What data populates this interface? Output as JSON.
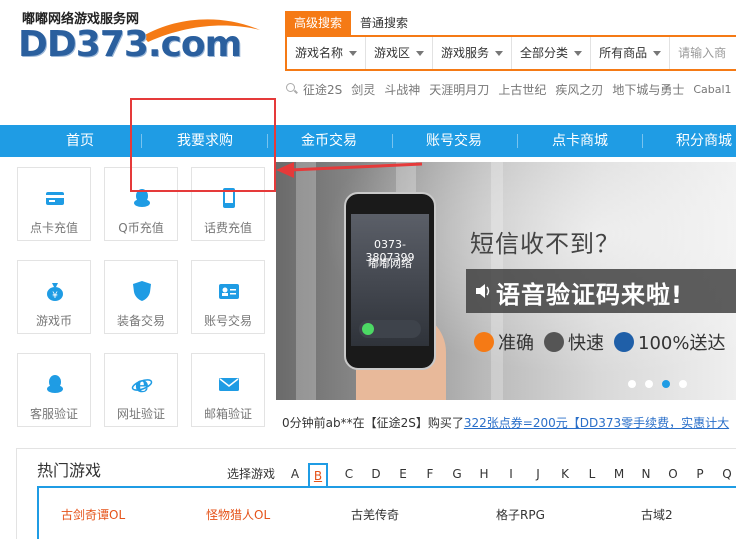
{
  "logo": {
    "tagline": "嘟嘟网络游戏服务网",
    "text": "DD373.com"
  },
  "search": {
    "tabs": [
      "高级搜索",
      "普通搜索"
    ],
    "fields": [
      "游戏名称",
      "游戏区",
      "游戏服务",
      "全部分类",
      "所有商品"
    ],
    "placeholder": "请输入商"
  },
  "hot_words": [
    "征途2S",
    "剑灵",
    "斗战神",
    "天涯明月刀",
    "上古世纪",
    "疾风之刃",
    "地下城与勇士",
    "Cabal1"
  ],
  "nav": [
    "首页",
    "我要求购",
    "金币交易",
    "账号交易",
    "点卡商城",
    "积分商城"
  ],
  "services": [
    {
      "label": "点卡充值",
      "icon": "card-icon"
    },
    {
      "label": "Q币充值",
      "icon": "qq-penguin-icon"
    },
    {
      "label": "话费充值",
      "icon": "phone-icon"
    },
    {
      "label": "游戏币",
      "icon": "money-bag-icon"
    },
    {
      "label": "装备交易",
      "icon": "shield-icon"
    },
    {
      "label": "账号交易",
      "icon": "id-card-icon"
    },
    {
      "label": "客服验证",
      "icon": "qq-penguin-icon"
    },
    {
      "label": "网址验证",
      "icon": "browser-e-icon"
    },
    {
      "label": "邮箱验证",
      "icon": "mail-icon"
    }
  ],
  "banner": {
    "phone_number": "0373-3807399",
    "phone_name": "嘟嘟网络",
    "title": "短信收不到？",
    "headline": "语音验证码来啦!",
    "features": [
      "准确",
      "快速",
      "100%送达"
    ],
    "slide_count": 4,
    "active_slide": 3
  },
  "ticker": {
    "prefix": "0分钟前ab**在【征途2S】购买了",
    "link": "322张点券=200元【DD373零手续费，实惠计大"
  },
  "hot_games": {
    "title": "热门游戏",
    "select_label": "选择游戏",
    "letters": [
      "A",
      "B",
      "C",
      "D",
      "E",
      "F",
      "G",
      "H",
      "I",
      "J",
      "K",
      "L",
      "M",
      "N",
      "O",
      "P",
      "Q"
    ],
    "active_letter": "B",
    "games": [
      "古剑奇谭OL",
      "怪物猎人OL",
      "古羌传奇",
      "格子RPG",
      "古域2"
    ]
  },
  "colors": {
    "primary_blue": "#1f9ce4",
    "accent_orange": "#f57a15",
    "annotation_red": "#e53a3a"
  }
}
